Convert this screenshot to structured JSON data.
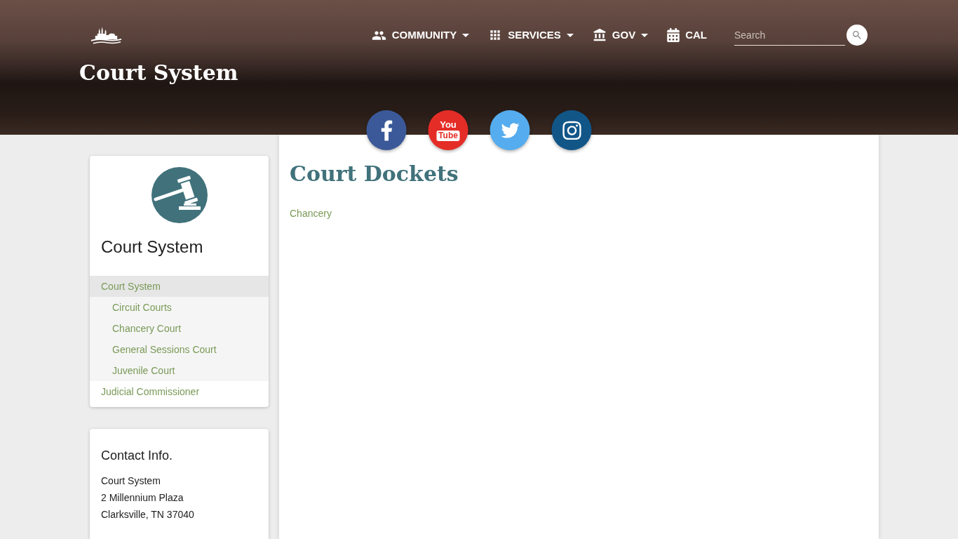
{
  "header": {
    "title": "Court System",
    "nav": [
      {
        "label": "COMMUNITY",
        "kind": "people",
        "has_menu": true
      },
      {
        "label": "SERVICES",
        "kind": "grid",
        "has_menu": true
      },
      {
        "label": "GOV",
        "kind": "bank",
        "has_menu": true
      },
      {
        "label": "CAL",
        "kind": "calendar",
        "has_menu": false
      }
    ],
    "search": {
      "placeholder": "Search"
    }
  },
  "social": [
    {
      "kind": "facebook"
    },
    {
      "kind": "youtube",
      "logo_text": [
        "You",
        "Tube"
      ]
    },
    {
      "kind": "twitter"
    },
    {
      "kind": "instagram"
    }
  ],
  "sidebar": {
    "title": "Court System",
    "nav": [
      {
        "label": "Court System",
        "selected": true,
        "expanded": true,
        "children": [
          {
            "label": "Circuit Courts",
            "selected": false
          },
          {
            "label": "Chancery Court",
            "selected": false
          },
          {
            "label": "General Sessions Court",
            "selected": false
          },
          {
            "label": "Juvenile Court",
            "selected": false
          }
        ]
      },
      {
        "label": "Judicial Commissioner",
        "selected": false
      }
    ]
  },
  "contact": {
    "title": "Contact Info.",
    "lines": [
      "Court System",
      "2 Millennium Plaza",
      "Clarksville, TN 37040"
    ]
  },
  "main": {
    "heading": "Court Dockets",
    "links": [
      "Chancery"
    ]
  }
}
